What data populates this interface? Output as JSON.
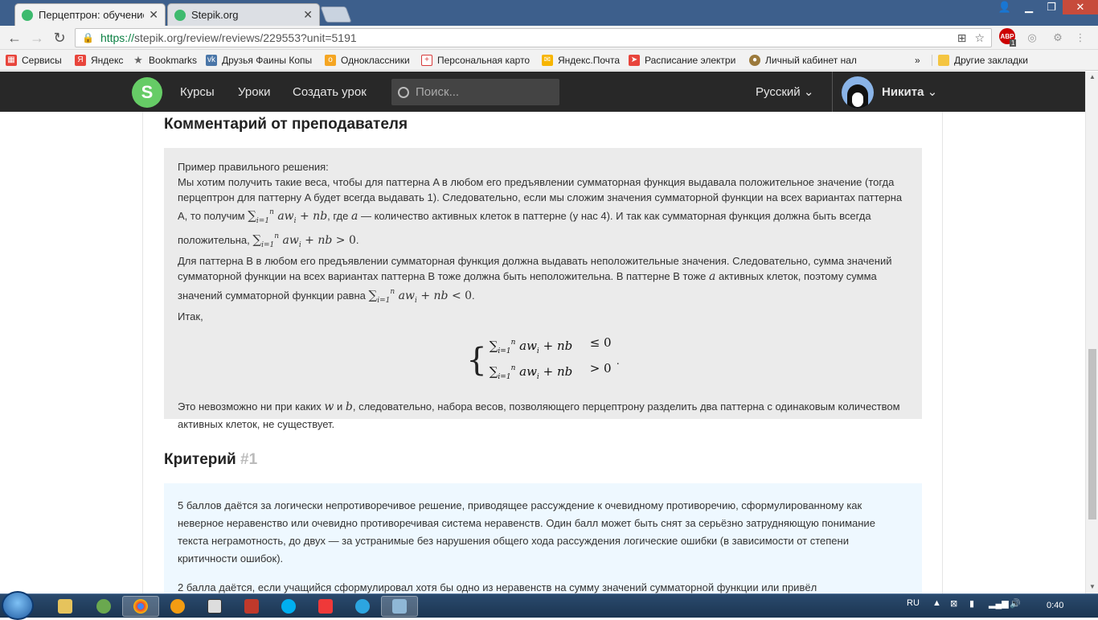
{
  "browser": {
    "tabs": [
      {
        "title": "Перцептрон: обучение",
        "active": true
      },
      {
        "title": "Stepik.org",
        "active": false
      }
    ],
    "url_scheme": "https://",
    "url_rest": "stepik.org/review/reviews/229553?unit=5191",
    "ext_badge": "1",
    "bookmarks": [
      {
        "label": "Сервисы",
        "icon": "apps-icon",
        "color": "#e8453c"
      },
      {
        "label": "Яндекс",
        "icon": "yandex-icon",
        "color": "#e8453c"
      },
      {
        "label": "Bookmarks",
        "icon": "star-icon",
        "color": "#666666"
      },
      {
        "label": "Друзья Фаины Копы",
        "icon": "vk-icon",
        "color": "#4a76a8"
      },
      {
        "label": "Одноклассники",
        "icon": "ok-icon",
        "color": "#f5a623"
      },
      {
        "label": "Персональная карто",
        "icon": "plus-icon",
        "color": "#d73a3a"
      },
      {
        "label": "Яндекс.Почта",
        "icon": "mail-icon",
        "color": "#f7b500"
      },
      {
        "label": "Расписание электри",
        "icon": "train-icon",
        "color": "#e8453c"
      },
      {
        "label": "Личный кабинет нал",
        "icon": "tax-icon",
        "color": "#9c7a3c"
      }
    ],
    "more_bookmarks": "»",
    "other_bookmarks": "Другие закладки"
  },
  "site": {
    "nav": [
      "Курсы",
      "Уроки",
      "Создать урок"
    ],
    "search_placeholder": "Поиск...",
    "language": "Русский",
    "user_name": "Никита"
  },
  "teacher_comment": {
    "heading": "Комментарий от преподавателя",
    "intro": "Пример правильного решения:",
    "p1_a": "Мы хотим получить такие веса, чтобы для паттерна A в любом его предъявлении сумматорная функция выдавала положительное значение (тогда перцептрон для паттерну A будет всегда выдавать 1). Следовательно, если мы сложим значения сумматорной функции на всех вариантах паттерна A, то получим ",
    "p1_b": ", где ",
    "p1_c": " — количество активных клеток в паттерне (у нас 4). И так как сумматорная функция должна быть всегда положительна, ",
    "p2_a": "Для паттерна B в любом его предъявлении сумматорная функция должна выдавать неположительные значения. Следовательно, сумма значений сумматорной функции на всех вариантах паттерна B тоже должна быть неположительна. В паттерне B тоже ",
    "p2_b": " активных клеток, поэтому сумма значений сумматорной функции равна ",
    "itak": "Итак,",
    "p3_a": "Это невозможно ни при каких ",
    "p3_b": " и ",
    "p3_c": ", следовательно, набора весов, позволяющего перцептрону разделить два паттерна с одинаковым количеством активных клеток, не существует."
  },
  "criterion": {
    "heading": "Критерий",
    "number": "#1",
    "p1": "5 баллов даётся за логически непротиворечивое решение, приводящее рассуждение к очевидному противоречию, сформулированному как неверное неравенство или очевидно противоречивая система неравенств.  Один балл может быть снят за серьёзно затрудняющую понимание текста неграмотность, до двух — за устранимые без нарушения общего хода рассуждения логические ошибки (в зависимости от степени критичности ошибок).",
    "p2": "2 балла даётся, если учащийся сформулировал хотя бы одно из неравенств на сумму значений сумматорной функции или привёл"
  },
  "taskbar": {
    "lang": "RU",
    "time": "0:40"
  }
}
